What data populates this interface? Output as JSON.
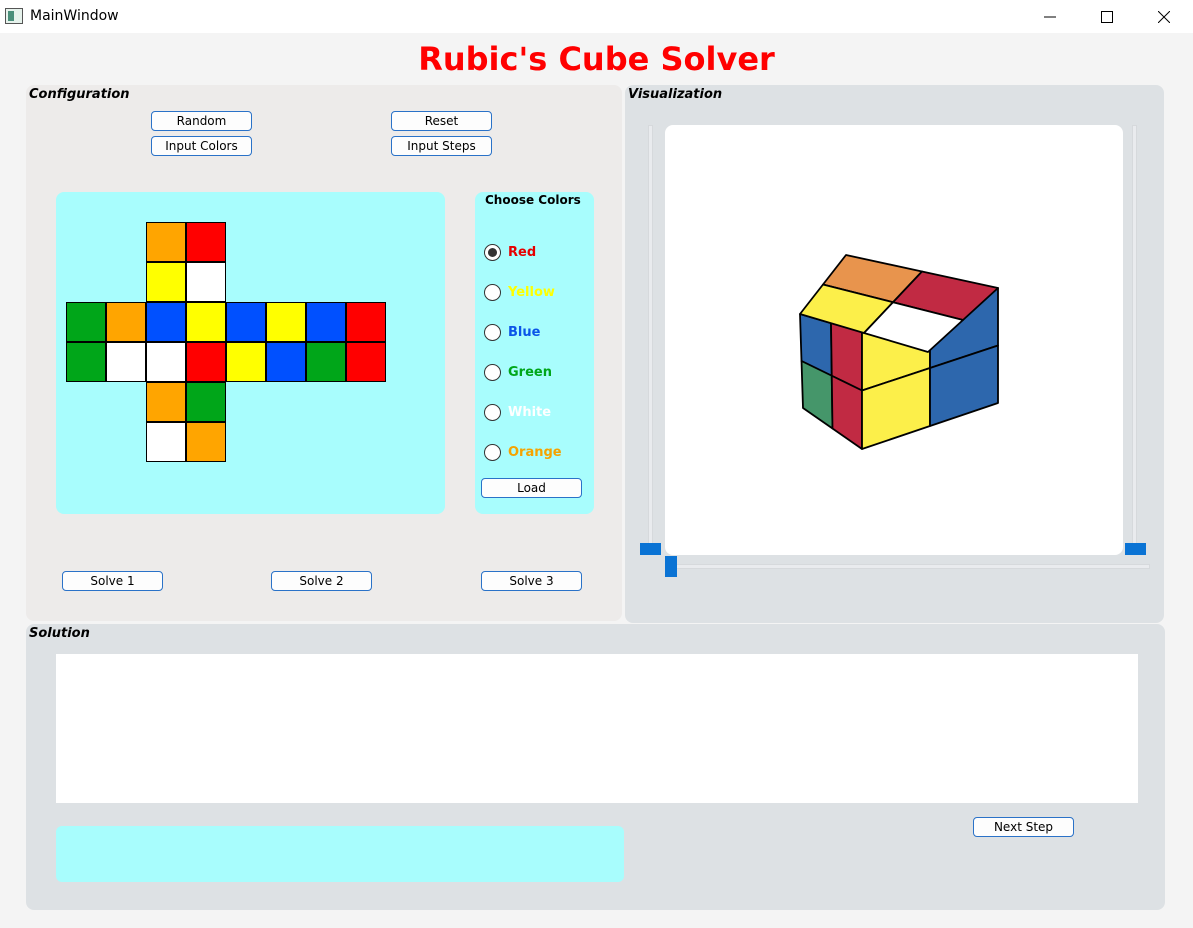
{
  "window": {
    "title": "MainWindow"
  },
  "app": {
    "title": "Rubic's Cube Solver"
  },
  "configuration": {
    "title": "Configuration",
    "buttons": {
      "random": "Random",
      "reset": "Reset",
      "input_colors": "Input Colors",
      "input_steps": "Input Steps",
      "solve1": "Solve 1",
      "solve2": "Solve 2",
      "solve3": "Solve 3"
    },
    "net": {
      "up": [
        "orange",
        "red",
        "yellow",
        "white"
      ],
      "left": [
        "green",
        "orange",
        "green",
        "white"
      ],
      "front": [
        "blue",
        "yellow",
        "white",
        "red"
      ],
      "right": [
        "blue",
        "yellow",
        "yellow",
        "blue"
      ],
      "back": [
        "blue",
        "red",
        "green",
        "red"
      ],
      "down": [
        "orange",
        "green",
        "white",
        "orange"
      ]
    },
    "color_hex": {
      "orange": "#ffa500",
      "red": "#ff0000",
      "yellow": "#ffff00",
      "white": "#ffffff",
      "green": "#00a619",
      "blue": "#0050ff"
    },
    "choose_colors": {
      "title": "Choose Colors",
      "options": [
        {
          "label": "Red",
          "color": "#e60000",
          "checked": true
        },
        {
          "label": "Yellow",
          "color": "#ffff00",
          "checked": false
        },
        {
          "label": "Blue",
          "color": "#0b55e8",
          "checked": false
        },
        {
          "label": "Green",
          "color": "#00a619",
          "checked": false
        },
        {
          "label": "White",
          "color": "#ffffff",
          "checked": false
        },
        {
          "label": "Orange",
          "color": "#f5a300",
          "checked": false
        }
      ],
      "load": "Load"
    }
  },
  "visualization": {
    "title": "Visualization",
    "cube_colors": {
      "orange": "#e8944d",
      "red": "#c12a43",
      "yellow": "#fcef4a",
      "white": "#ffffff",
      "blue": "#2d67ad",
      "green": "#45966a"
    },
    "top_face": [
      "orange",
      "red",
      "yellow",
      "white"
    ],
    "front_face": [
      "blue",
      "red",
      "green",
      "red"
    ],
    "right_face": [
      "yellow",
      "blue",
      "yellow",
      "blue"
    ]
  },
  "solution": {
    "title": "Solution",
    "text": "",
    "status": "",
    "next_step": "Next Step"
  }
}
